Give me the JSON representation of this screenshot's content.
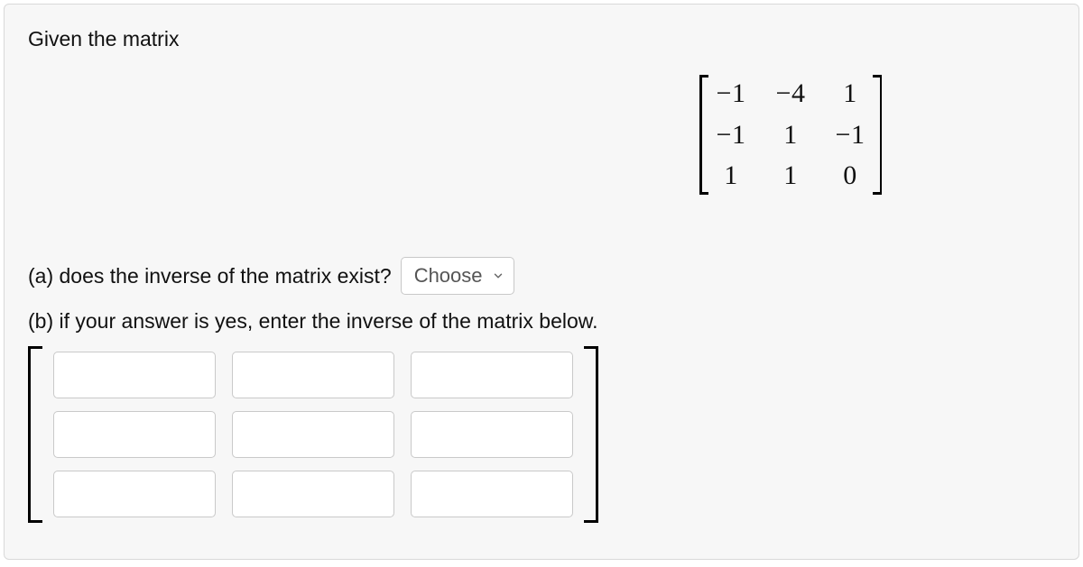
{
  "prompt": "Given the matrix",
  "matrix": {
    "rows": [
      [
        "−1",
        "−4",
        "1"
      ],
      [
        "−1",
        "1",
        "−1"
      ],
      [
        "1",
        "1",
        "0"
      ]
    ]
  },
  "question_a": {
    "label": "(a) does the inverse of the matrix exist?",
    "select_placeholder": "Choose"
  },
  "question_b": {
    "label": "(b) if your answer is yes, enter the inverse of the matrix below."
  },
  "answer_matrix": {
    "cells": [
      "",
      "",
      "",
      "",
      "",
      "",
      "",
      "",
      ""
    ]
  }
}
